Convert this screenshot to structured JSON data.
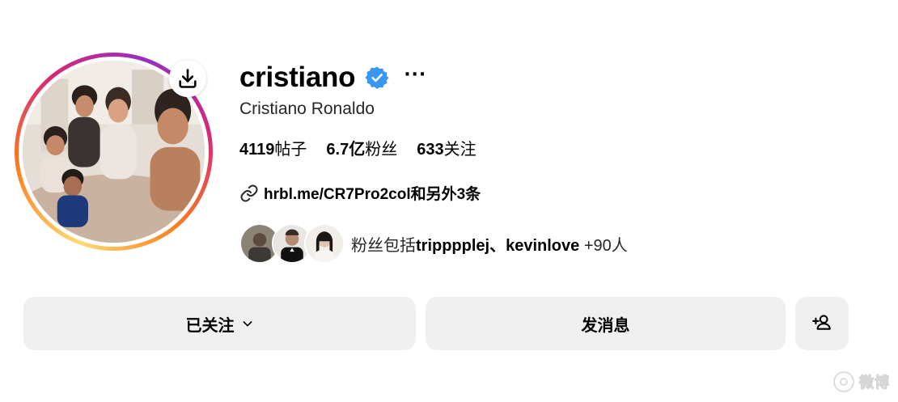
{
  "profile": {
    "username": "cristiano",
    "full_name": "Cristiano Ronaldo",
    "more_label": "···",
    "verified_color": "#3897f0",
    "gradient_colors": [
      "#feda75",
      "#fa7e1e",
      "#d62976",
      "#962fbf"
    ]
  },
  "stats": [
    {
      "value": "4119",
      "label": "帖子"
    },
    {
      "value": "6.7亿",
      "label": "粉丝"
    },
    {
      "value": "633",
      "label": "关注"
    }
  ],
  "link": {
    "text": "hrbl.me/CR7Pro2col和另外3条"
  },
  "followed_by": {
    "prefix": "粉丝包括",
    "names": "tripppplej、kevinlove",
    "more": " +90人"
  },
  "buttons": {
    "following": "已关注",
    "message": "发消息"
  },
  "watermark": {
    "text": "微博"
  },
  "icons": [
    "download-icon",
    "verified-badge-icon",
    "more-icon",
    "link-icon",
    "chevron-down-icon",
    "add-person-icon"
  ]
}
